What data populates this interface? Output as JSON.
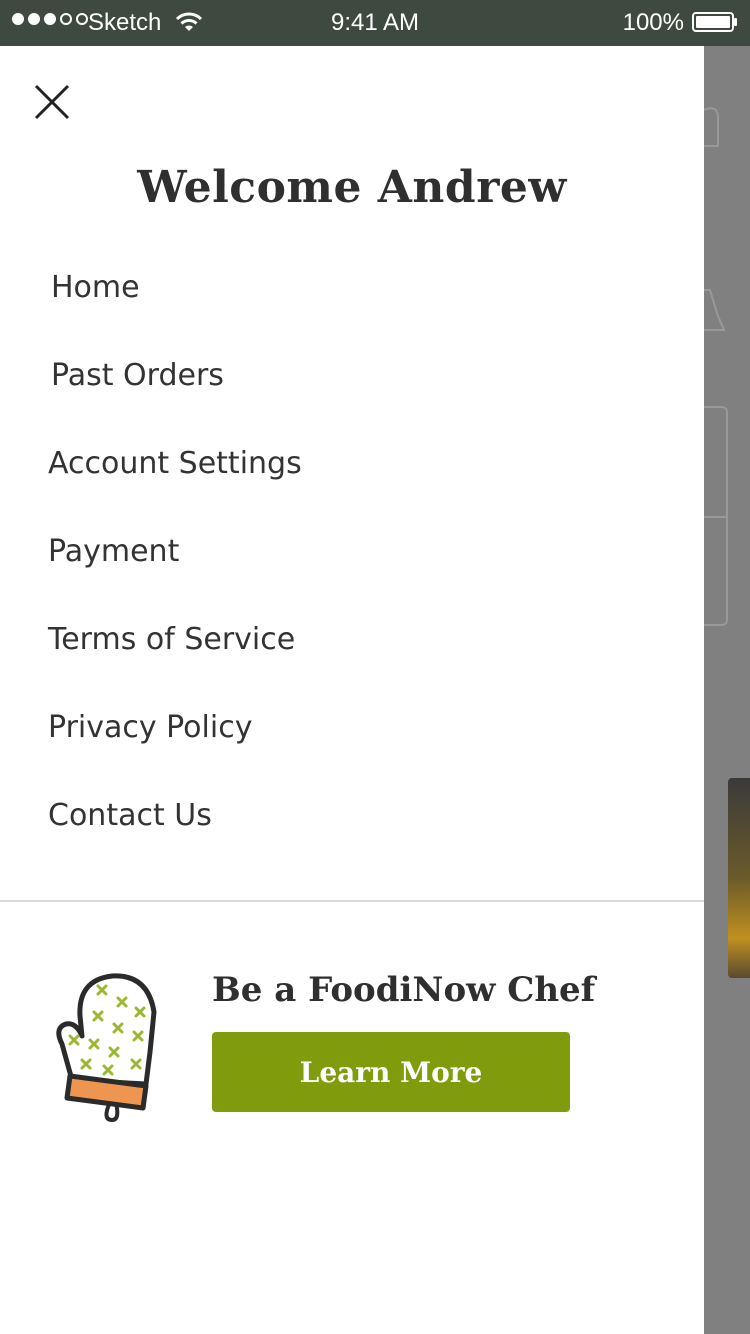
{
  "status_bar": {
    "carrier": "Sketch",
    "time": "9:41 AM",
    "battery": "100%"
  },
  "drawer": {
    "welcome": "Welcome Andrew",
    "menu": [
      {
        "label": "Home"
      },
      {
        "label": "Past Orders"
      },
      {
        "label": "Account Settings"
      },
      {
        "label": "Payment"
      },
      {
        "label": "Terms of Service"
      },
      {
        "label": "Privacy Policy"
      },
      {
        "label": "Contact Us"
      }
    ],
    "promo": {
      "title": "Be a FoodiNow Chef",
      "button_label": "Learn More",
      "icon": "oven-mitt-icon"
    }
  },
  "colors": {
    "status_bar_bg": "#3e4a40",
    "accent_green": "#809c0c",
    "mitt_cuff": "#ee9650",
    "mitt_pattern": "#9ab830",
    "overlay": "#808080"
  }
}
